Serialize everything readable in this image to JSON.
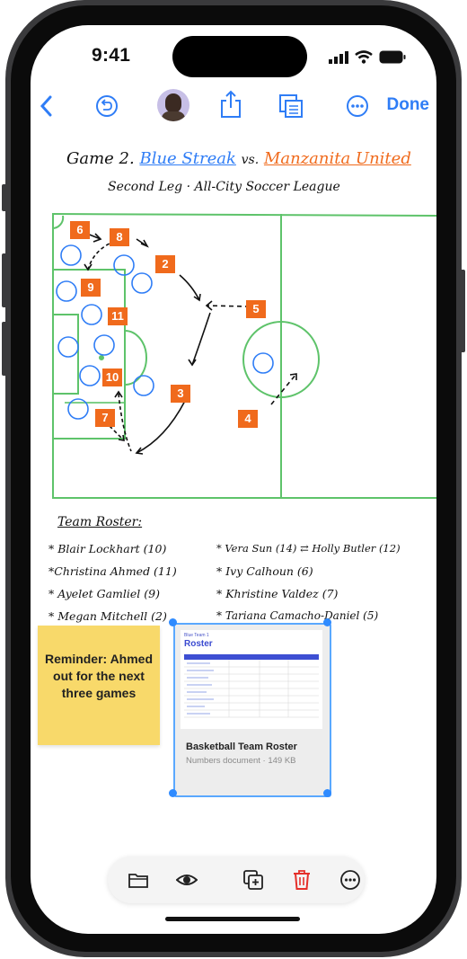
{
  "status": {
    "time": "9:41"
  },
  "toolbar": {
    "done_label": "Done"
  },
  "board": {
    "title_prefix": "Game 2.",
    "team_home": "Blue Streak",
    "vs": "vs.",
    "team_away": "Manzanita United",
    "subtitle": "Second Leg · All-City Soccer League",
    "players": [
      "6",
      "8",
      "2",
      "9",
      "11",
      "5",
      "10",
      "3",
      "7",
      "4"
    ]
  },
  "roster": {
    "heading": "Team Roster:",
    "left": [
      "* Blair Lockhart (10)",
      "*Christina Ahmed (11)",
      "* Ayelet Gamliel (9)",
      "* Megan Mitchell (2)"
    ],
    "right": [
      "* Vera Sun (14) ⇄ Holly Butler (12)",
      "* Ivy Calhoun (6)",
      "* Khristine Valdez (7)",
      "* Tariana Camacho-Daniel (5)"
    ]
  },
  "sticky": {
    "text": "Reminder: Ahmed out for the next three games"
  },
  "document": {
    "title": "Basketball Team Roster",
    "subtitle": "Numbers document · 149 KB",
    "thumb_kicker": "Blue Team 1",
    "thumb_heading": "Roster"
  },
  "colors": {
    "accent": "#2f7df6",
    "home": "#2f7df6",
    "away": "#f06a1c",
    "field": "#5ec36a",
    "sticky": "#f8d96a"
  }
}
